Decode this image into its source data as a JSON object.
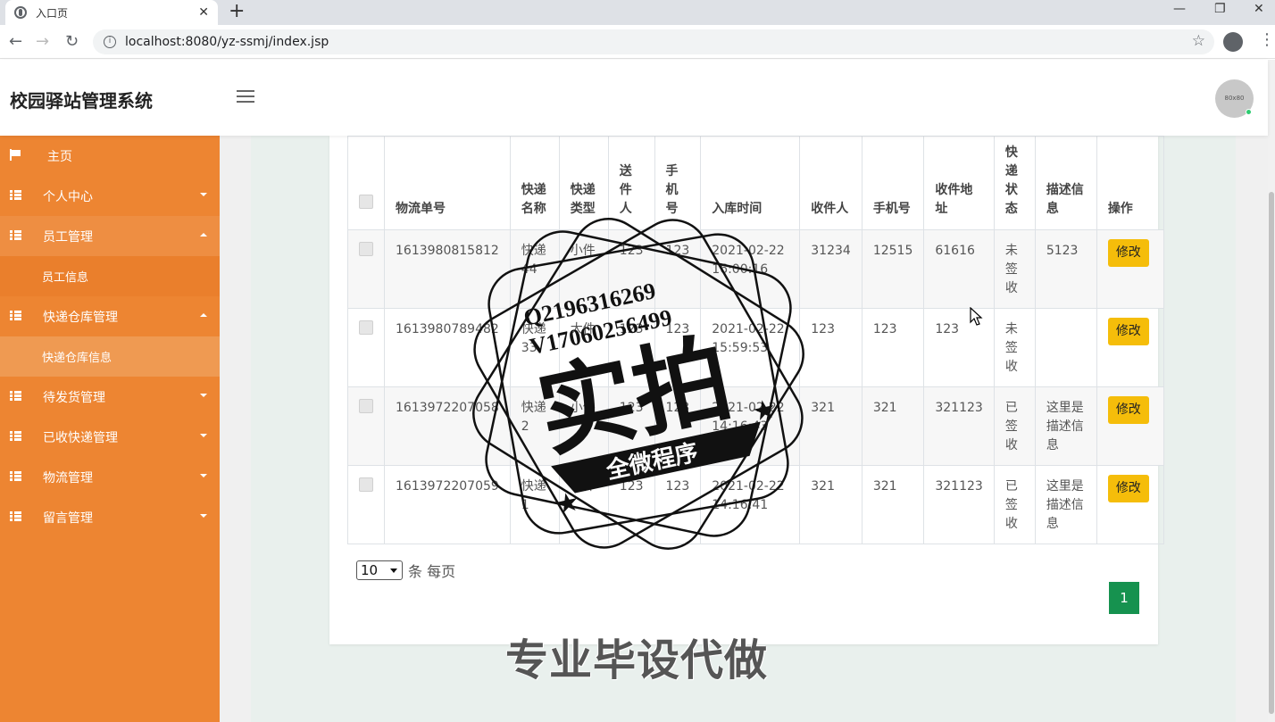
{
  "browser": {
    "tab_title": "入口页",
    "tab_close": "✕",
    "new_tab": "+",
    "url": "localhost:8080/yz-ssmj/index.jsp",
    "controls": {
      "minimize": "—",
      "restore": "❐",
      "close": "✕"
    }
  },
  "header": {
    "brand": "校园驿站管理系统",
    "avatar_text": "80x80"
  },
  "sidebar": {
    "items": [
      {
        "label": "主页",
        "icon": "flag-icon"
      },
      {
        "label": "个人中心",
        "icon": "grid-icon",
        "caret": "down"
      },
      {
        "label": "员工管理",
        "icon": "grid-icon",
        "caret": "up",
        "sub": "员工信息"
      },
      {
        "label": "快递仓库管理",
        "icon": "grid-icon",
        "caret": "up",
        "sub": "快递仓库信息"
      },
      {
        "label": "待发货管理",
        "icon": "grid-icon",
        "caret": "down"
      },
      {
        "label": "已收快递管理",
        "icon": "grid-icon",
        "caret": "down"
      },
      {
        "label": "物流管理",
        "icon": "grid-icon",
        "caret": "down"
      },
      {
        "label": "留言管理",
        "icon": "grid-icon",
        "caret": "down"
      }
    ]
  },
  "table": {
    "headers": [
      "物流单号",
      "快递名称",
      "快递类型",
      "送件人",
      "手机号",
      "入库时间",
      "收件人",
      "手机号",
      "收件地址",
      "快递状态",
      "描述信息",
      "操作"
    ],
    "edit_label": "修改",
    "rows": [
      [
        "1613980815812",
        "快递44",
        "小件",
        "123",
        "123",
        "2021-02-22 16:00:16",
        "31234",
        "12515",
        "61616",
        "未签收",
        "5123"
      ],
      [
        "1613980789482",
        "快递33",
        "大件",
        "123",
        "123",
        "2021-02-22 15:59:53",
        "123",
        "123",
        "123",
        "未签收",
        ""
      ],
      [
        "1613972207058",
        "快递2",
        "小件",
        "123",
        "123",
        "2021-02-22 14:16:43",
        "321",
        "321",
        "321123",
        "已签收",
        "这里是描述信息"
      ],
      [
        "1613972207059",
        "快递1",
        "小件",
        "123",
        "123",
        "2021-02-22 14:16:41",
        "321",
        "321",
        "321123",
        "已签收",
        "这里是描述信息"
      ]
    ]
  },
  "pager": {
    "page_size": "10",
    "per_page_text": "条 每页",
    "current_page": "1"
  },
  "watermark": {
    "contact_q": "Q2196316269",
    "contact_v": "V17060256499",
    "stamp_big": "实拍",
    "stamp_ribbon": "全微程序",
    "banner": "专业毕设代做"
  },
  "colors": {
    "sidebar": "#ed8532",
    "edit_button": "#f5bd0a",
    "page_active": "#16924f"
  }
}
